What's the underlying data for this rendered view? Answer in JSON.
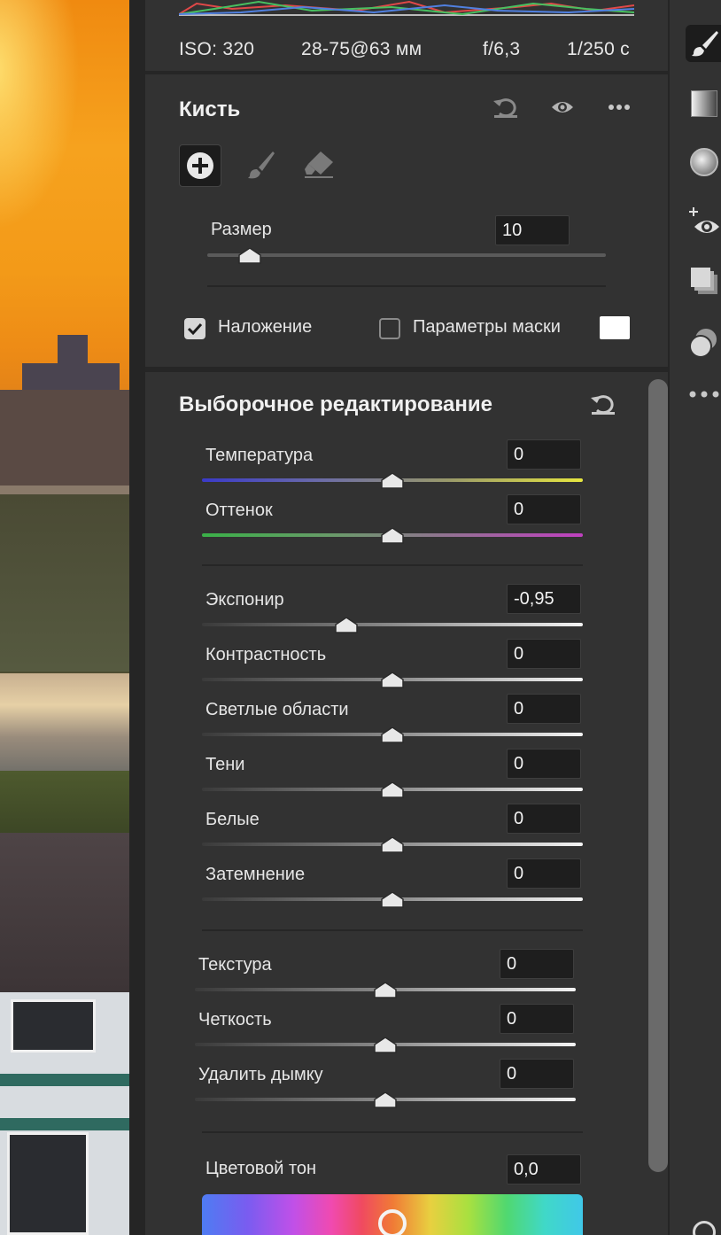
{
  "meta": {
    "iso": "ISO: 320",
    "lens": "28-75@63 мм",
    "aperture": "f/6,3",
    "shutter": "1/250 с"
  },
  "brush": {
    "title": "Кисть",
    "size_label": "Размер",
    "size_value": "10",
    "size_level": 0.09,
    "overlay_label": "Наложение",
    "overlay_checked": true,
    "mask_label": "Параметры маски",
    "mask_checked": false,
    "mask_color": "#ffffff"
  },
  "selective": {
    "title": "Выборочное редактирование",
    "sliders": [
      {
        "label": "Температура",
        "value": "0",
        "level": 0.5,
        "track": "temp"
      },
      {
        "label": "Оттенок",
        "value": "0",
        "level": 0.5,
        "track": "tint"
      },
      {
        "label": "Экспонир",
        "value": "-0,95",
        "level": 0.38,
        "track": "gray"
      },
      {
        "label": "Контрастность",
        "value": "0",
        "level": 0.5,
        "track": "gray"
      },
      {
        "label": "Светлые области",
        "value": "0",
        "level": 0.5,
        "track": "gray"
      },
      {
        "label": "Тени",
        "value": "0",
        "level": 0.5,
        "track": "gray"
      },
      {
        "label": "Белые",
        "value": "0",
        "level": 0.5,
        "track": "gray"
      },
      {
        "label": "Затемнение",
        "value": "0",
        "level": 0.5,
        "track": "gray"
      },
      {
        "label": "Текстура",
        "value": "0",
        "level": 0.5,
        "track": "gray"
      },
      {
        "label": "Четкость",
        "value": "0",
        "level": 0.5,
        "track": "gray"
      },
      {
        "label": "Удалить дымку",
        "value": "0",
        "level": 0.5,
        "track": "gray"
      }
    ],
    "hue_label": "Цветовой тон",
    "hue_value": "0,0",
    "hue_level": 0.5
  },
  "colors": {
    "panel_bg": "#323232",
    "input_bg": "#1e1e1e",
    "accent_check": "#d8d8d8"
  },
  "toolbar": {
    "tools": [
      "brush-tool-icon",
      "linear-gradient-icon",
      "radial-gradient-icon",
      "red-eye-icon",
      "layers-icon",
      "masks-icon",
      "more-tools-icon"
    ]
  }
}
